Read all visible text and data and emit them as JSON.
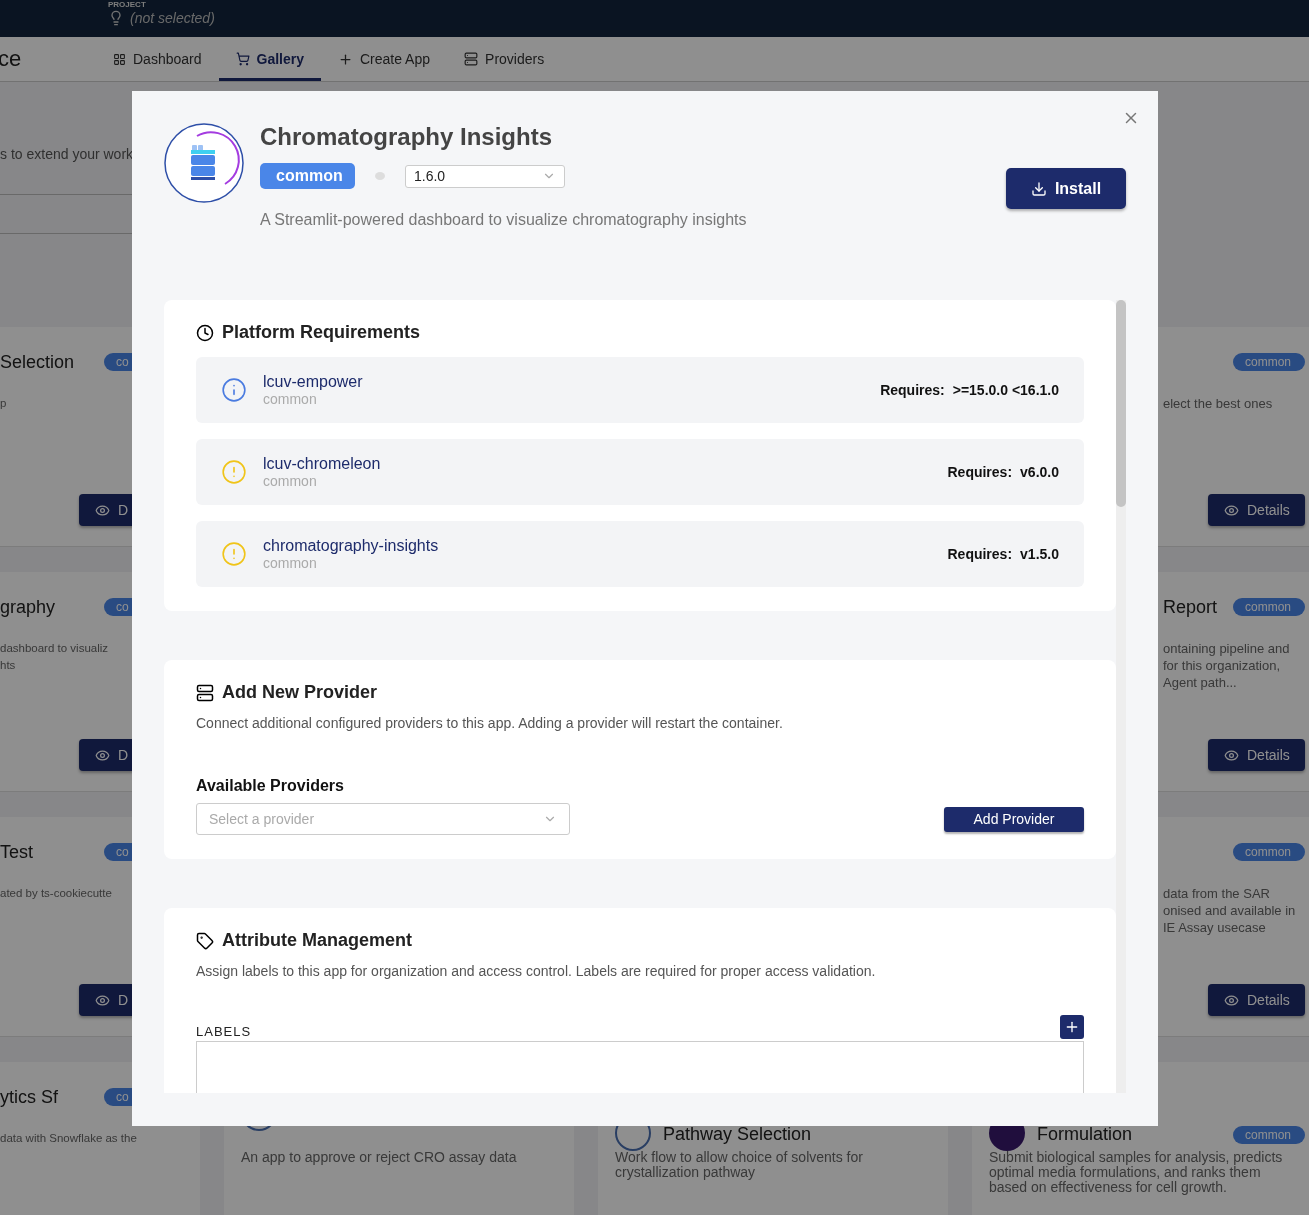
{
  "top_bar": {
    "project_label": "PROJECT",
    "project_value": "(not selected)"
  },
  "nav": {
    "title": "ce",
    "tabs": [
      {
        "label": "Dashboard",
        "selected": false
      },
      {
        "label": "Gallery",
        "selected": true
      },
      {
        "label": "Create App",
        "selected": false
      },
      {
        "label": "Providers",
        "selected": false
      }
    ]
  },
  "gallery": {
    "subtitle": "s to extend your work",
    "left_cards": [
      {
        "title": "Selection",
        "badge": "co",
        "description": [
          "p"
        ],
        "button": "D"
      },
      {
        "title": "graphy",
        "badge": "co",
        "description": [
          "dashboard to visualiz",
          "hts"
        ],
        "button": "D"
      },
      {
        "title": "Test",
        "badge": "co",
        "description": [
          "ated by ts-cookiecutte"
        ],
        "button": "D"
      },
      {
        "title": "ytics Sf",
        "badge": "co",
        "description": [
          "data with Snowflake as the"
        ]
      }
    ],
    "right_cards": [
      {
        "badge": "common",
        "description": [
          "elect the best ones"
        ],
        "button": "Details"
      },
      {
        "title": "Report",
        "badge": "common",
        "description": [
          "ontaining pipeline and",
          "for this organization,",
          "Agent path..."
        ],
        "button": "Details"
      },
      {
        "badge": "common",
        "description": [
          "data from the SAR",
          "onised and available in",
          "IE Assay usecase"
        ],
        "button": "Details"
      }
    ],
    "bottom_cards": [
      {
        "description": [
          "An app to approve or reject CRO assay data"
        ]
      },
      {
        "title": "Pathway Selection",
        "description": [
          "Work flow to allow choice of solvents for",
          "crystallization pathway"
        ]
      },
      {
        "title": "Formulation",
        "badge": "common",
        "description": [
          "Submit biological samples for analysis, predicts",
          "optimal media formulations, and ranks them",
          "based on effectiveness for cell growth."
        ]
      }
    ]
  },
  "modal": {
    "title": "Chromatography Insights",
    "badge": "common",
    "version": "1.6.0",
    "install_button": "Install",
    "description": "A Streamlit-powered dashboard to visualize chromatography insights",
    "platform_requirements": {
      "title": "Platform Requirements",
      "items": [
        {
          "name": "lcuv-empower",
          "scope": "common",
          "kind": "info",
          "requires_label": "Requires:",
          "requires_value": ">=15.0.0 <16.1.0"
        },
        {
          "name": "lcuv-chromeleon",
          "scope": "common",
          "kind": "warning",
          "requires_label": "Requires:",
          "requires_value": "v6.0.0"
        },
        {
          "name": "chromatography-insights",
          "scope": "common",
          "kind": "warning",
          "requires_label": "Requires:",
          "requires_value": "v1.5.0"
        }
      ]
    },
    "add_provider": {
      "title": "Add New Provider",
      "description": "Connect additional configured providers to this app. Adding a provider will restart the container.",
      "field_label": "Available Providers",
      "placeholder": "Select a provider",
      "button": "Add Provider"
    },
    "attributes": {
      "title": "Attribute Management",
      "description": "Assign labels to this app for organization and access control. Labels are required for proper access validation.",
      "labels_heading": "LABELS"
    }
  }
}
